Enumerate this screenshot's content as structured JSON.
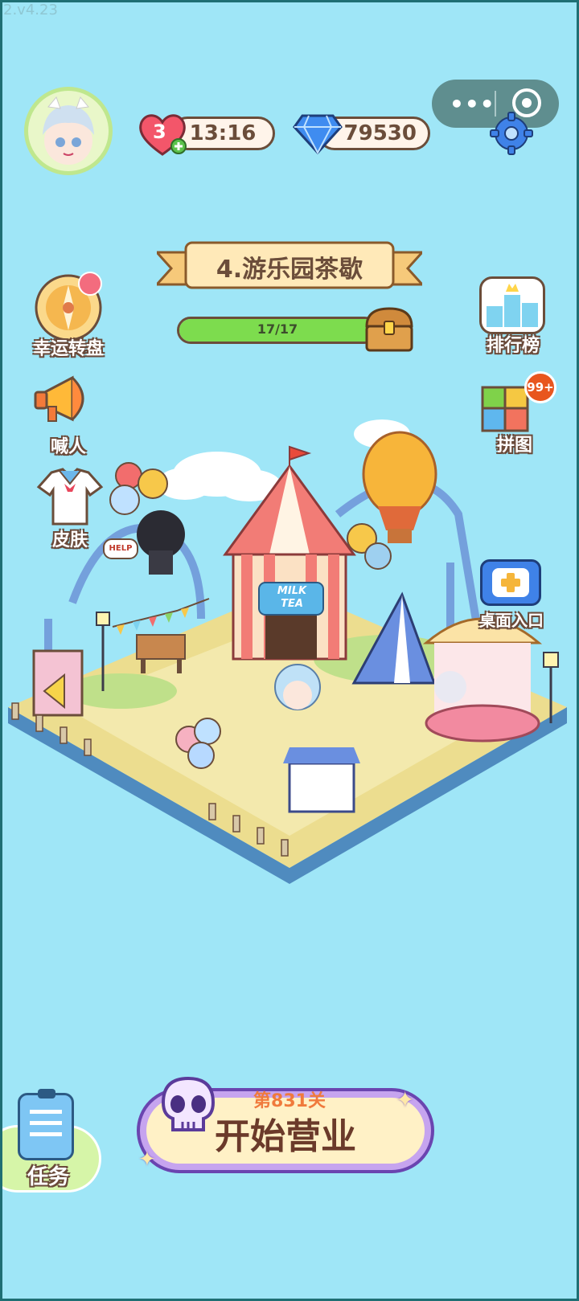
{
  "version": "2.v4.23",
  "hud": {
    "lives": "3",
    "timer": "13:16",
    "gems": "79530"
  },
  "level": {
    "title": "4.游乐园茶歇",
    "progress_text": "17/17",
    "progress": 1.0
  },
  "left_menu": {
    "lucky_wheel": "幸运转盘",
    "shout": "喊人",
    "skin": "皮肤"
  },
  "right_menu": {
    "ranking": "排行榜",
    "puzzle": "拼图",
    "puzzle_badge": "99+",
    "desktop": "桌面入口"
  },
  "scene": {
    "milk_tea_line1": "MILK",
    "milk_tea_line2": "TEA",
    "help": "HELP"
  },
  "bottom": {
    "task": "任务",
    "stage": "第831关",
    "start": "开始营业"
  },
  "colors": {
    "background": "#9fe6f7",
    "outline": "#6b4d3a",
    "progress_fill": "#7ddc4e",
    "start_button": "#fff1c6",
    "start_border": "#8a5fc7"
  }
}
